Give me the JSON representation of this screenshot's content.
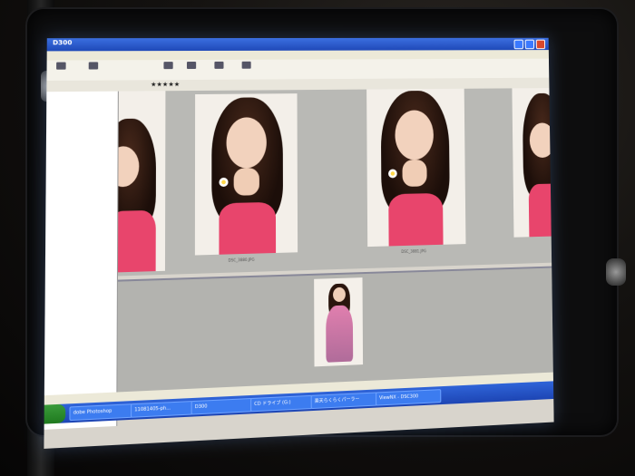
{
  "window": {
    "title": "D300"
  },
  "taskbar": {
    "items": [
      "dobe Photoshop",
      "11081405-ph...",
      "D300",
      "CD ドライブ (G:)",
      "楽天らくらくパーラー",
      "ViewNX - DSC300"
    ]
  },
  "thumbnails": [
    {
      "caption": ""
    },
    {
      "caption": "DSC_3880.JPG"
    },
    {
      "caption": "DSC_3881.JPG"
    },
    {
      "caption": ""
    }
  ],
  "colors": {
    "titlebar": "#2a5bd0",
    "taskbar": "#2555c8",
    "accent_pink": "#e8456c"
  },
  "icons": [
    "folder-icon",
    "rotate-icon",
    "print-icon",
    "mail-icon",
    "slideshow-icon",
    "fileconvert-icon",
    "star-icon"
  ]
}
